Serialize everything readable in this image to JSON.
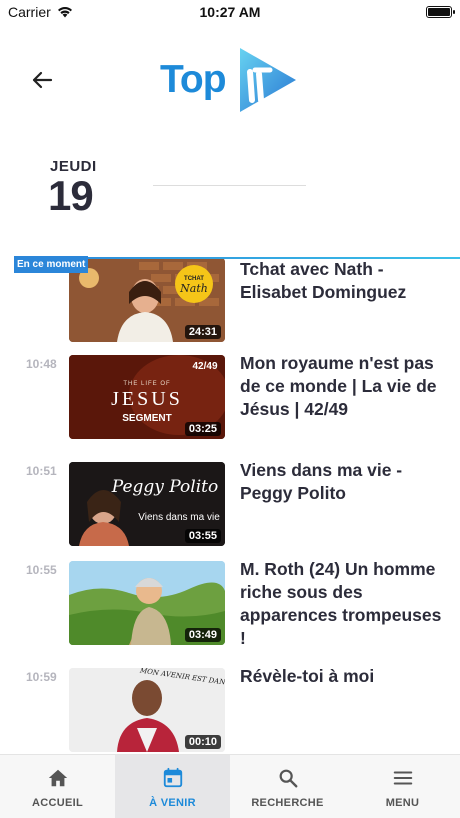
{
  "status_bar": {
    "carrier": "Carrier",
    "time": "10:27 AM",
    "icons": [
      "wifi-icon",
      "battery-icon"
    ]
  },
  "header": {
    "back_icon": "arrow-left-icon",
    "logo_text": "Top",
    "logo_brand": "TopTV",
    "brand_colors": {
      "primary": "#1d8ad9",
      "secondary": "#5fd0f0"
    }
  },
  "date": {
    "day_name": "JEUDI",
    "day_number": "19"
  },
  "now_badge": "En ce moment",
  "programs": [
    {
      "time": "",
      "title": "Tchat avec Nath - Elisabet Dominguez",
      "duration": "24:31",
      "thumb_text": [
        "TCHAT",
        "Nath"
      ]
    },
    {
      "time": "10:48",
      "title": "Mon royaume n'est pas de ce monde | La vie de Jésus | 42/49",
      "duration": "03:25",
      "thumb_text": [
        "42/49",
        "THE LIFE OF",
        "JESUS",
        "SEGMENT"
      ]
    },
    {
      "time": "10:51",
      "title": "Viens dans ma vie - Peggy Polito",
      "duration": "03:55",
      "thumb_text": [
        "Peggy Polito",
        "Viens dans ma vie"
      ]
    },
    {
      "time": "10:55",
      "title": "M. Roth (24) Un homme riche sous des apparences trompeuses !",
      "duration": "03:49",
      "thumb_text": []
    },
    {
      "time": "10:59",
      "title": "Révèle-toi à moi",
      "duration": "00:10",
      "thumb_text": [
        "MON AVENIR EST DANS TES MAINS"
      ]
    }
  ],
  "tab_bar": {
    "tabs": [
      {
        "label": "ACCUEIL",
        "icon": "home-icon",
        "active": false
      },
      {
        "label": "À VENIR",
        "icon": "calendar-icon",
        "active": true
      },
      {
        "label": "RECHERCHE",
        "icon": "search-icon",
        "active": false
      },
      {
        "label": "MENU",
        "icon": "menu-icon",
        "active": false
      }
    ]
  }
}
